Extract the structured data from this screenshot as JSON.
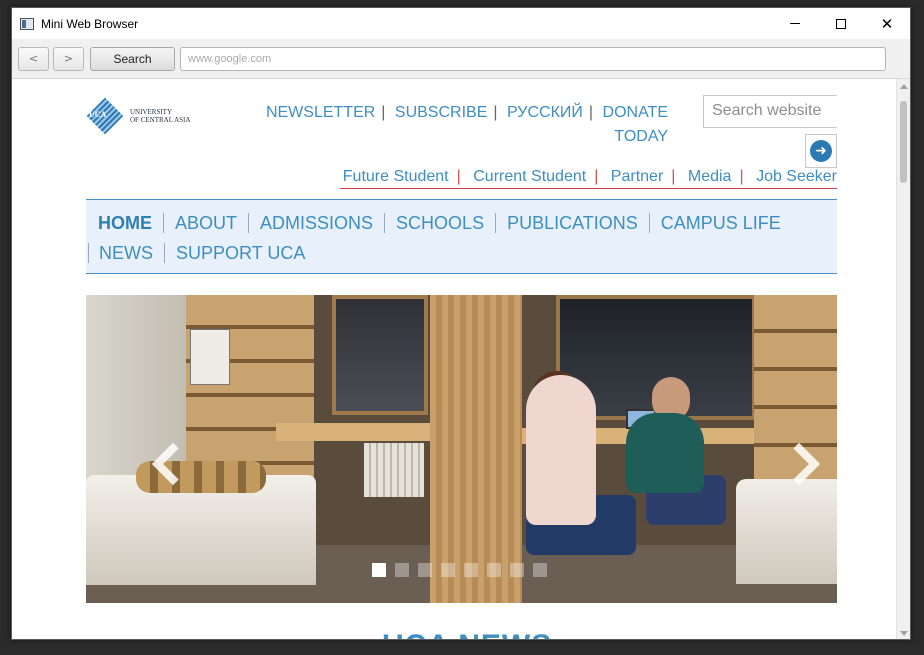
{
  "window": {
    "title": "Mini Web Browser"
  },
  "toolbar": {
    "back_label": "<",
    "forward_label": ">",
    "search_label": "Search",
    "url_placeholder": "www.google.com"
  },
  "site": {
    "logo_abbr": "UCA",
    "logo_text_line1": "UNIVERSITY",
    "logo_text_line2": "OF CENTRAL ASIA",
    "top_links": [
      "NEWSLETTER",
      "SUBSCRIBE",
      "РУССКИЙ",
      "DONATE TODAY"
    ],
    "search_placeholder": "Search website",
    "audience_links": [
      "Future Student",
      "Current Student",
      "Partner",
      "Media",
      "Job Seeker"
    ],
    "nav_row1": [
      "HOME",
      "ABOUT",
      "ADMISSIONS",
      "SCHOOLS",
      "PUBLICATIONS",
      "CAMPUS LIFE"
    ],
    "nav_row2": [
      "NEWS",
      "SUPPORT UCA"
    ],
    "active_nav": "HOME",
    "slider": {
      "slide_count": 8,
      "active_index": 0
    },
    "section_heading": "UCA NEWS"
  },
  "colors": {
    "link": "#3e8ec0",
    "nav_background": "#e8f1fb",
    "divider_red": "#d04040"
  }
}
